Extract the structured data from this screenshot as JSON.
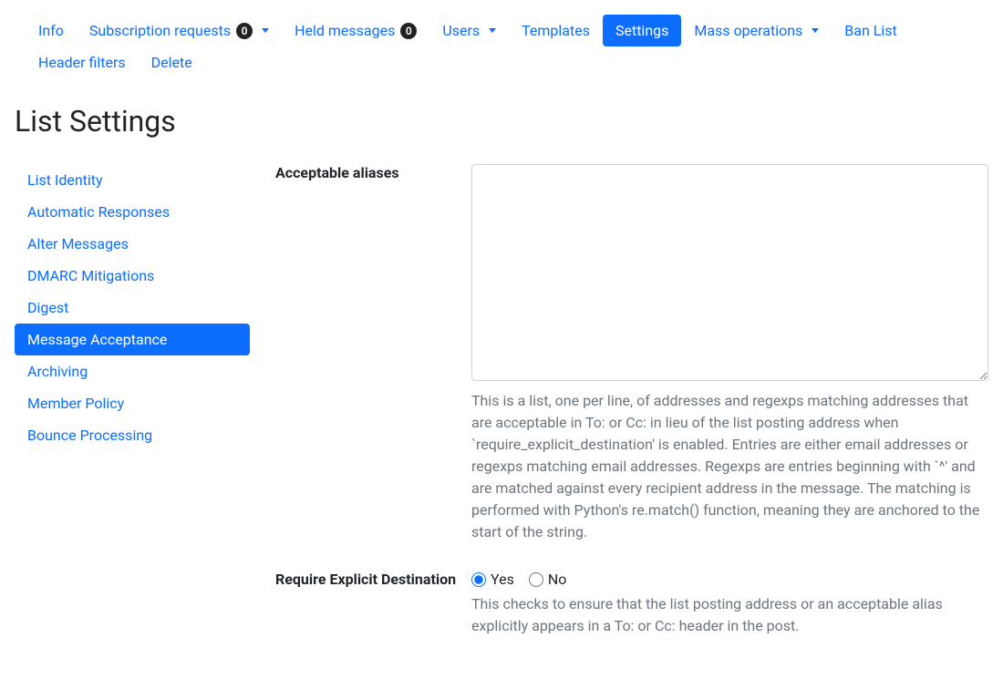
{
  "nav": {
    "info": "Info",
    "subscription_requests": "Subscription requests",
    "subscription_badge": "0",
    "held_messages": "Held messages",
    "held_badge": "0",
    "users": "Users",
    "templates": "Templates",
    "settings": "Settings",
    "mass_operations": "Mass operations",
    "ban_list": "Ban List",
    "header_filters": "Header filters",
    "delete": "Delete"
  },
  "page_title": "List Settings",
  "sidenav": {
    "list_identity": "List Identity",
    "automatic_responses": "Automatic Responses",
    "alter_messages": "Alter Messages",
    "dmarc_mitigations": "DMARC Mitigations",
    "digest": "Digest",
    "message_acceptance": "Message Acceptance",
    "archiving": "Archiving",
    "member_policy": "Member Policy",
    "bounce_processing": "Bounce Processing"
  },
  "form": {
    "acceptable_aliases": {
      "label": "Acceptable aliases",
      "value": "",
      "help": "This is a list, one per line, of addresses and regexps matching addresses that are acceptable in To: or Cc: in lieu of the list posting address when `require_explicit_destination' is enabled. Entries are either email addresses or regexps matching email addresses. Regexps are entries beginning with `^' and are matched against every recipient address in the message. The matching is performed with Python's re.match() function, meaning they are anchored to the start of the string."
    },
    "require_explicit_destination": {
      "label": "Require Explicit Destination",
      "yes": "Yes",
      "no": "No",
      "help": "This checks to ensure that the list posting address or an acceptable alias explicitly appears in a To: or Cc: header in the post."
    }
  }
}
